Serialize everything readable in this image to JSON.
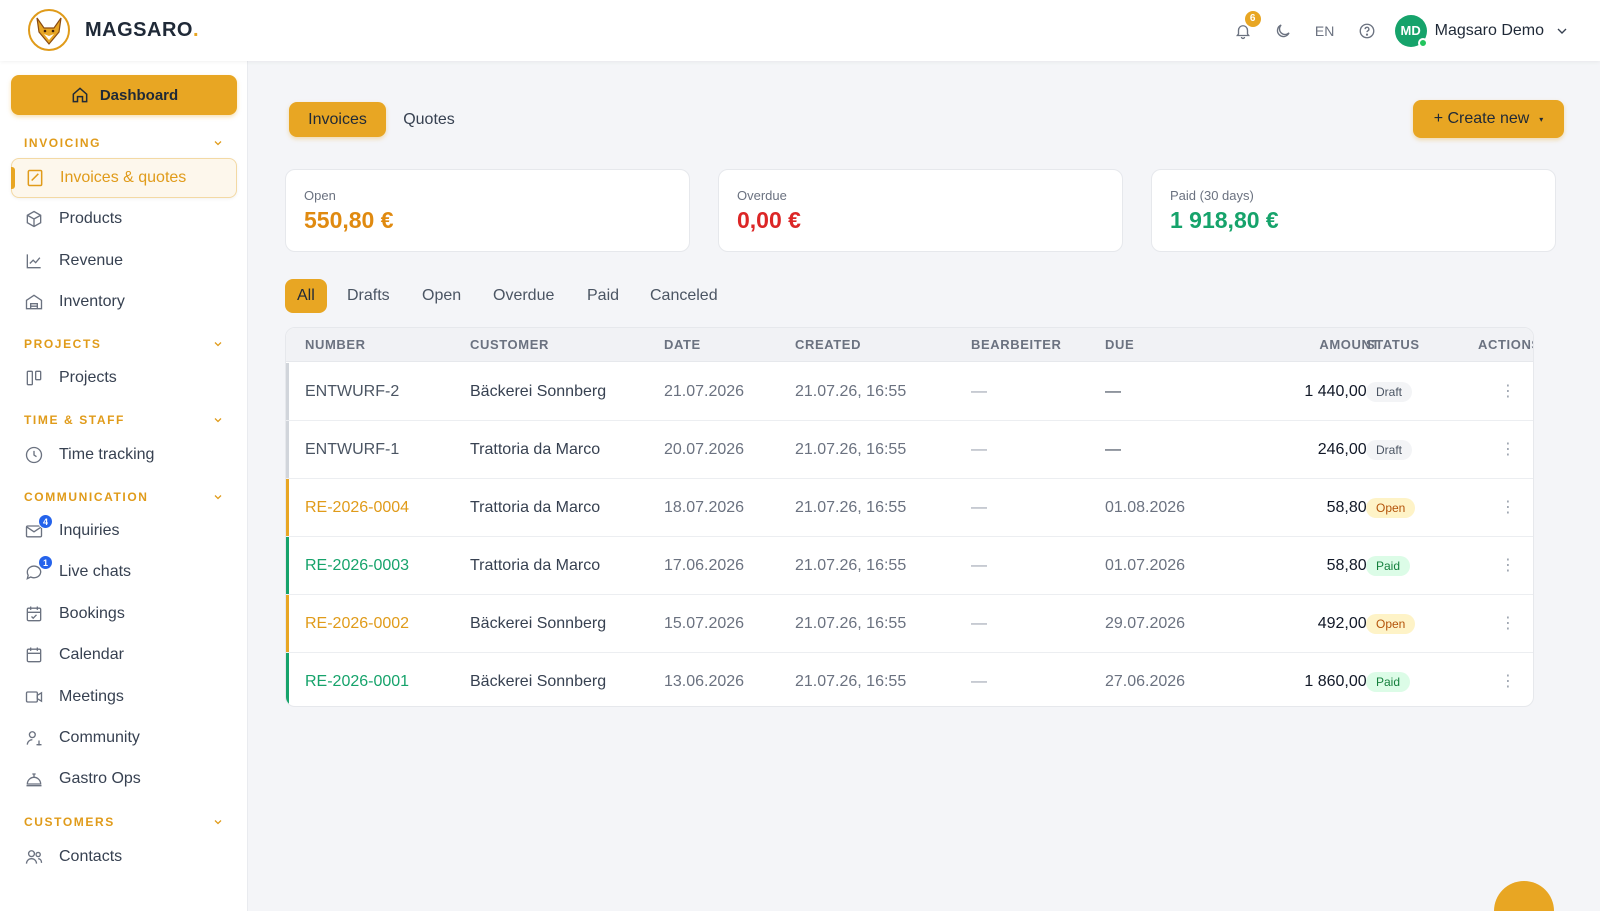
{
  "brand": {
    "name": "MAGSARO",
    "dot": "."
  },
  "header": {
    "notifications_count": "6",
    "language": "EN",
    "user_initials": "MD",
    "user_name": "Magsaro Demo"
  },
  "sidebar": {
    "dashboard_label": "Dashboard",
    "sections": {
      "invoicing": "INVOICING",
      "projects": "PROJECTS",
      "time_staff": "TIME & STAFF",
      "communication": "COMMUNICATION",
      "customers": "CUSTOMERS"
    },
    "items": {
      "invoices_quotes": "Invoices & quotes",
      "products": "Products",
      "revenue": "Revenue",
      "inventory": "Inventory",
      "projects": "Projects",
      "time_tracking": "Time tracking",
      "inquiries": "Inquiries",
      "inquiries_badge": "4",
      "live_chats": "Live chats",
      "live_chats_badge": "1",
      "bookings": "Bookings",
      "calendar": "Calendar",
      "meetings": "Meetings",
      "community": "Community",
      "gastro_ops": "Gastro Ops",
      "contacts": "Contacts"
    }
  },
  "main": {
    "doc_tabs": {
      "invoices": "Invoices",
      "quotes": "Quotes"
    },
    "create_label": "+ Create new",
    "create_caret": "▾",
    "kpis": {
      "open_label": "Open",
      "open_value": "550,80 €",
      "overdue_label": "Overdue",
      "overdue_value": "0,00 €",
      "paid_label": "Paid (30 days)",
      "paid_value": "1 918,80 €"
    },
    "filters": {
      "all": "All",
      "drafts": "Drafts",
      "open": "Open",
      "overdue": "Overdue",
      "paid": "Paid",
      "canceled": "Canceled"
    },
    "columns": {
      "number": "NUMBER",
      "customer": "CUSTOMER",
      "date": "DATE",
      "created": "CREATED",
      "bearbeiter": "BEARBEITER",
      "due": "DUE",
      "amount": "AMOUNT",
      "status": "STATUS",
      "actions": "ACTIONS"
    },
    "rows": [
      {
        "number": "ENTWURF-2",
        "customer": "Bäckerei Sonnberg",
        "date": "21.07.2026",
        "created": "21.07.26, 16:55",
        "bearbeiter": "—",
        "due": "—",
        "amount": "1 440,00 €",
        "status": "Draft"
      },
      {
        "number": "ENTWURF-1",
        "customer": "Trattoria da Marco",
        "date": "20.07.2026",
        "created": "21.07.26, 16:55",
        "bearbeiter": "—",
        "due": "—",
        "amount": "246,00 €",
        "status": "Draft"
      },
      {
        "number": "RE-2026-0004",
        "customer": "Trattoria da Marco",
        "date": "18.07.2026",
        "created": "21.07.26, 16:55",
        "bearbeiter": "—",
        "due": "01.08.2026",
        "amount": "58,80 €",
        "status": "Open"
      },
      {
        "number": "RE-2026-0003",
        "customer": "Trattoria da Marco",
        "date": "17.06.2026",
        "created": "21.07.26, 16:55",
        "bearbeiter": "—",
        "due": "01.07.2026",
        "amount": "58,80 €",
        "status": "Paid"
      },
      {
        "number": "RE-2026-0002",
        "customer": "Bäckerei Sonnberg",
        "date": "15.07.2026",
        "created": "21.07.26, 16:55",
        "bearbeiter": "—",
        "due": "29.07.2026",
        "amount": "492,00 €",
        "status": "Open"
      },
      {
        "number": "RE-2026-0001",
        "customer": "Bäckerei Sonnberg",
        "date": "13.06.2026",
        "created": "21.07.26, 16:55",
        "bearbeiter": "—",
        "due": "27.06.2026",
        "amount": "1 860,00 €",
        "status": "Paid"
      }
    ],
    "kebab": "⋮"
  },
  "colors": {
    "accent": "#e8a623",
    "open": "#e08a10",
    "overdue": "#dc2626",
    "paid": "#16a36b"
  }
}
